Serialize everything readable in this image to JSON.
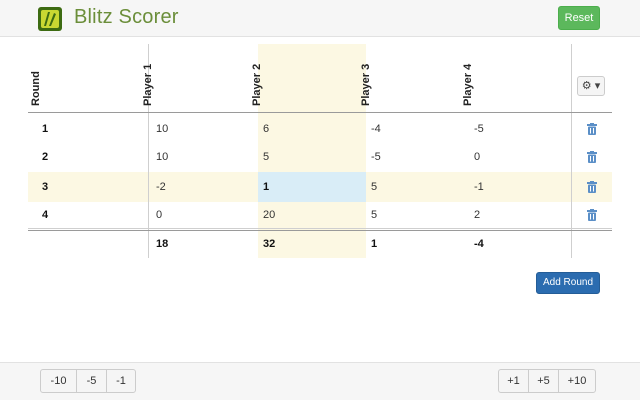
{
  "header": {
    "title": "Blitz Scorer",
    "reset_label": "Reset"
  },
  "table": {
    "round_header": "Round",
    "players": [
      "Player 1",
      "Player 2",
      "Player 3",
      "Player 4"
    ],
    "rows": [
      {
        "round": "1",
        "scores": [
          "10",
          "6",
          "-4",
          "-5"
        ]
      },
      {
        "round": "2",
        "scores": [
          "10",
          "5",
          "-5",
          "0"
        ]
      },
      {
        "round": "3",
        "scores": [
          "-2",
          "1",
          "5",
          "-1"
        ]
      },
      {
        "round": "4",
        "scores": [
          "0",
          "20",
          "5",
          "2"
        ]
      }
    ],
    "totals": [
      "18",
      "32",
      "1",
      "-4"
    ],
    "highlight": {
      "player_index": 1,
      "round_index": 2
    }
  },
  "settings_icon": "gear-icon",
  "delete_icon": "trash-icon",
  "add_round_label": "Add Round",
  "footer": {
    "decrement": [
      "-10",
      "-5",
      "-1"
    ],
    "increment": [
      "+1",
      "+5",
      "+10"
    ]
  },
  "colors": {
    "brand": "#6b8e3a",
    "reset": "#5cb85c",
    "add_round": "#2b6cb0",
    "highlight": "#fcf8e3",
    "selected_cell": "#d9edf7",
    "trash": "#5b8fc7"
  }
}
